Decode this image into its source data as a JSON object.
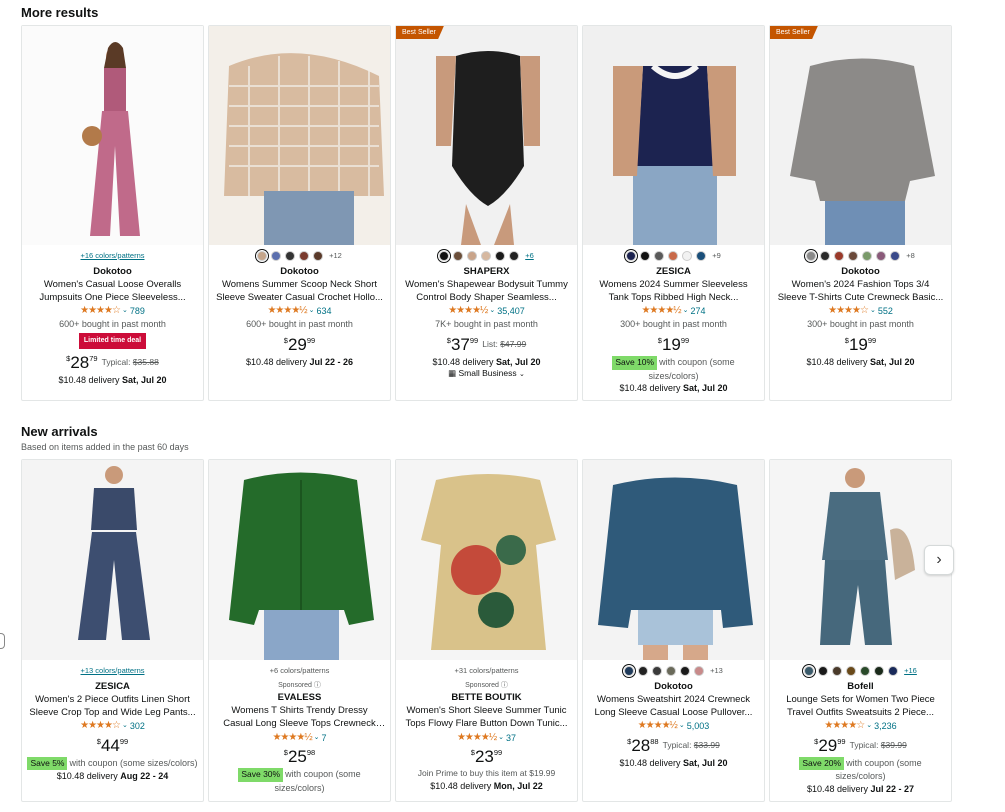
{
  "sections": {
    "more_results": {
      "title": "More results"
    },
    "new_arrivals": {
      "title": "New arrivals",
      "subtitle": "Based on items added in the past 60 days"
    }
  },
  "row1": [
    {
      "colors_link": "+16 colors/patterns",
      "brand": "Dokotoo",
      "title": "Women's Casual Loose Overalls Jumpsuits One Piece Sleeveless...",
      "stars": "★★★★☆",
      "rating_count": "789",
      "bought": "600+ bought in past month",
      "deal_badge": "Limited time deal",
      "price_whole": "28",
      "price_frac": "79",
      "typical_label": "Typical:",
      "typical_price": "$35.88",
      "delivery_prefix": "$10.48 delivery",
      "delivery_date": "Sat, Jul 20",
      "image_bg": "#e9e2e4"
    },
    {
      "swatches": [
        "#c5a58a",
        "#5b6fae",
        "#333333",
        "#7a3b2e",
        "#5a3a2a"
      ],
      "swatch_more": "+12",
      "brand": "Dokotoo",
      "title": "Womens Summer Scoop Neck Short Sleeve Sweater Casual Crochet Hollo...",
      "stars": "★★★★½",
      "rating_count": "634",
      "bought": "600+ bought in past month",
      "price_whole": "29",
      "price_frac": "99",
      "delivery_prefix": "$10.48 delivery",
      "delivery_date": "Jul 22 - 26",
      "image_bg": "#e6dcd2"
    },
    {
      "best_seller": "Best Seller",
      "swatches": [
        "#111111",
        "#6b4f3a",
        "#c9a48a",
        "#d6b8a0",
        "#1a1a1a",
        "#222222"
      ],
      "swatch_more": "+6",
      "brand": "SHAPERX",
      "title": "Women's Shapewear Bodysuit Tummy Control Body Shaper Seamless...",
      "stars": "★★★★½",
      "rating_count": "35,407",
      "bought": "7K+ bought in past month",
      "price_whole": "37",
      "price_frac": "99",
      "list_label": "List:",
      "list_price": "$47.99",
      "delivery_prefix": "$10.48 delivery",
      "delivery_date": "Sat, Jul 20",
      "small_business": "Small Business",
      "image_bg": "#efefef"
    },
    {
      "swatches": [
        "#1c2350",
        "#111111",
        "#5a5a5a",
        "#c96a4a",
        "#f2f2f2",
        "#1a4f7a"
      ],
      "swatch_more": "+9",
      "brand": "ZESICA",
      "title": "Womens 2024 Summer Sleeveless Tank Tops Ribbed High Neck...",
      "stars": "★★★★½",
      "rating_count": "274",
      "bought": "300+ bought in past month",
      "price_whole": "19",
      "price_frac": "99",
      "save_badge": "Save 10%",
      "coupon_text": "with coupon (some sizes/colors)",
      "delivery_prefix": "$10.48 delivery",
      "delivery_date": "Sat, Jul 20",
      "image_bg": "#ececec"
    },
    {
      "best_seller": "Best Seller",
      "swatches": [
        "#8a8a8a",
        "#2a2a2a",
        "#9a3a2a",
        "#6b4a3a",
        "#7a9a6a",
        "#8a5a7a",
        "#3a4a8a"
      ],
      "swatch_more": "+8",
      "brand": "Dokotoo",
      "title": "Women's 2024 Fashion Tops 3/4 Sleeve T-Shirts Cute Crewneck Basic...",
      "stars": "★★★★☆",
      "rating_count": "552",
      "bought": "300+ bought in past month",
      "price_whole": "19",
      "price_frac": "99",
      "delivery_prefix": "$10.48 delivery",
      "delivery_date": "Sat, Jul 20",
      "image_bg": "#e9e9e9"
    }
  ],
  "row2": [
    {
      "colors_link": "+13 colors/patterns",
      "brand": "ZESICA",
      "title": "Women's 2 Piece Outfits Linen Short Sleeve Crop Top and Wide Leg Pants...",
      "stars": "★★★★☆",
      "rating_count": "302",
      "price_whole": "44",
      "price_frac": "99",
      "save_badge": "Save 5%",
      "coupon_text": "with coupon (some sizes/colors)",
      "delivery_prefix": "$10.48 delivery",
      "delivery_date": "Aug 22 - 24",
      "image_bg": "#efefef"
    },
    {
      "colors_text": "+6 colors/patterns",
      "sponsored": "Sponsored ⓘ",
      "brand": "EVALESS",
      "title": "Womens T Shirts Trendy Dressy Casual Long Sleeve Tops Crewneck Pleated...",
      "stars": "★★★★½",
      "rating_count": "7",
      "price_whole": "25",
      "price_frac": "98",
      "save_badge": "Save 30%",
      "coupon_text": "with coupon (some sizes/colors)",
      "image_bg": "#f2f2f2"
    },
    {
      "colors_text": "+31 colors/patterns",
      "sponsored": "Sponsored ⓘ",
      "brand": "BETTE BOUTIK",
      "title": "Women's Short Sleeve Summer Tunic Tops Flowy Flare Button Down Tunic...",
      "stars": "★★★★½",
      "rating_count": "37",
      "price_whole": "23",
      "price_frac": "99",
      "prime_text": "Join Prime to buy this item at $19.99",
      "delivery_prefix": "$10.48 delivery",
      "delivery_date": "Mon, Jul 22",
      "image_bg": "#f2f2f2"
    },
    {
      "swatches": [
        "#1f3a5a",
        "#222222",
        "#3a3a3a",
        "#6a6a5a",
        "#1a1a1a",
        "#c88a8a"
      ],
      "swatch_more": "+13",
      "brand": "Dokotoo",
      "title": "Womens Sweatshirt 2024 Crewneck Long Sleeve Casual Loose Pullover...",
      "stars": "★★★★½",
      "rating_count": "5,003",
      "price_whole": "28",
      "price_frac": "88",
      "typical_label": "Typical:",
      "typical_price": "$33.99",
      "delivery_prefix": "$10.48 delivery",
      "delivery_date": "Sat, Jul 20",
      "image_bg": "#eeeeee"
    },
    {
      "swatches": [
        "#3a5a6a",
        "#1a1a1a",
        "#4a3a2a",
        "#6a4a1a",
        "#2a4a2a",
        "#1a2a1a",
        "#1a2a5a"
      ],
      "swatch_more": "+16",
      "brand": "Bofell",
      "title": "Lounge Sets for Women Two Piece Travel Outfits Sweatsuits 2 Piece...",
      "stars": "★★★★☆",
      "rating_count": "3,236",
      "price_whole": "29",
      "price_frac": "99",
      "typical_label": "Typical:",
      "typical_price": "$39.99",
      "save_badge": "Save 20%",
      "coupon_text": "with coupon (some sizes/colors)",
      "delivery_prefix": "$10.48 delivery",
      "delivery_date": "Jul 22 - 27",
      "image_bg": "#f0f0f0"
    }
  ],
  "carousel": {
    "next_icon": "›"
  }
}
